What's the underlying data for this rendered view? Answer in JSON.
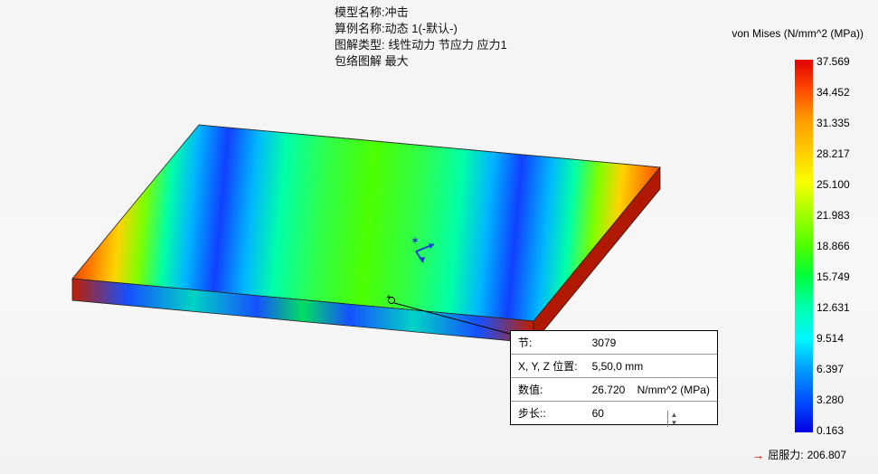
{
  "header": {
    "model_name_label": "模型名称:",
    "model_name": "冲击",
    "study_name_label": "算例名称:",
    "study_name": "动态 1(-默认-)",
    "plot_type_label": "图解类型:",
    "plot_type": "线性动力 节应力 应力1",
    "envelope_label": "包络图解",
    "envelope_value": "最大"
  },
  "legend": {
    "title": "von Mises (N/mm^2 (MPa))",
    "ticks": [
      "37.569",
      "34.452",
      "31.335",
      "28.217",
      "25.100",
      "21.983",
      "18.866",
      "15.749",
      "12.631",
      "9.514",
      "6.397",
      "3.280",
      "0.163"
    ]
  },
  "yield": {
    "label": "屈服力:",
    "value": "206.807"
  },
  "probe": {
    "node_label": "节:",
    "node_value": "3079",
    "xyz_label": "X, Y, Z 位置:",
    "xyz_value": "5,50,0 mm",
    "value_label": "数值:",
    "value_num": "26.720",
    "value_unit": "N/mm^2 (MPa)",
    "step_label": "步长::",
    "step_value": "60"
  },
  "chart_data": {
    "type": "heatmap",
    "title": "von Mises (N/mm^2 (MPa))",
    "range": [
      0.163,
      37.569
    ],
    "probe_sample": {
      "node": 3079,
      "xyz_mm": [
        5,
        50,
        0
      ],
      "value": 26.72,
      "step": 60
    },
    "yield_strength": 206.807
  }
}
